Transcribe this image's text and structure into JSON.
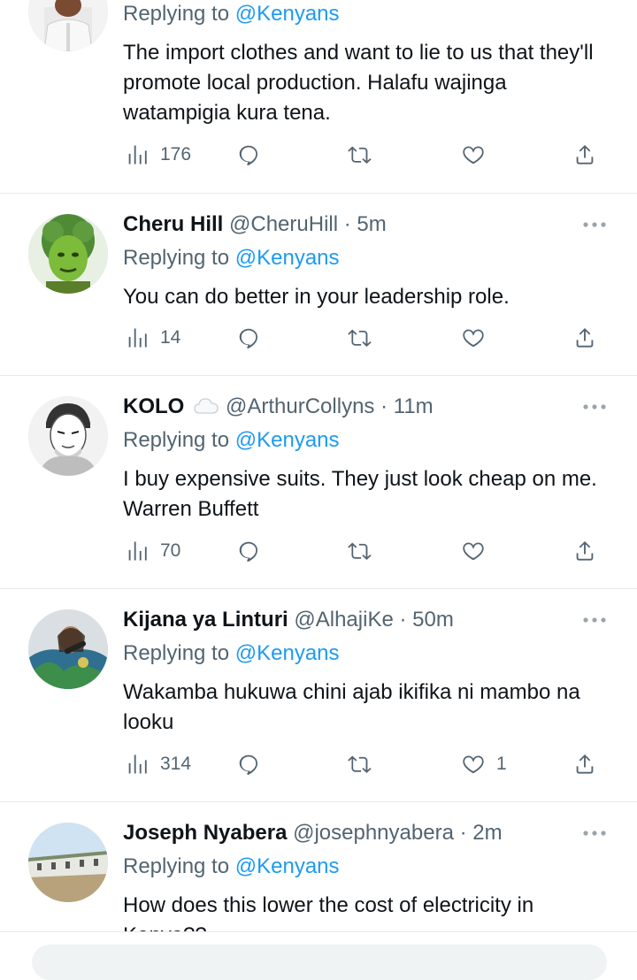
{
  "tweets": [
    {
      "name": "",
      "handle": "",
      "time": "",
      "replying_prefix": "Replying to ",
      "replying_to": "@Kenyans",
      "text": "The import clothes and want to lie to us that they'll promote local production. Halafu wajinga watampigia kura tena.",
      "views": "176",
      "likes": ""
    },
    {
      "name": "Cheru Hill",
      "handle": "@CheruHill",
      "time": "5m",
      "replying_prefix": "Replying to ",
      "replying_to": "@Kenyans",
      "text": "You can do better in your leadership role.",
      "views": "14",
      "likes": ""
    },
    {
      "name": "KOLO",
      "handle": "@ArthurCollyns",
      "time": "11m",
      "replying_prefix": "Replying to ",
      "replying_to": "@Kenyans",
      "text": "I buy expensive suits. They just look cheap on me. Warren Buffett",
      "views": "70",
      "likes": ""
    },
    {
      "name": "Kijana ya Linturi",
      "handle": "@AlhajiKe",
      "time": "50m",
      "replying_prefix": "Replying to ",
      "replying_to": "@Kenyans",
      "text": "Wakamba hukuwa chini ajab ikifika ni mambo na looku",
      "views": "314",
      "likes": "1"
    },
    {
      "name": "Joseph Nyabera",
      "handle": "@josephnyabera",
      "time": "2m",
      "replying_prefix": "Replying to ",
      "replying_to": "@Kenyans",
      "text": "How does this lower the cost of electricity in Kenya??",
      "views": "",
      "likes": ""
    }
  ],
  "separator": "·",
  "icons": {
    "views": "views-bar-chart-icon",
    "reply": "reply-bubble-icon",
    "retweet": "retweet-icon",
    "like": "heart-icon",
    "share": "share-upload-icon",
    "more": "more-dots-icon"
  },
  "colors": {
    "text": "#0f1419",
    "secondary": "#536471",
    "mention": "#1d9bf0",
    "divider": "#e6e9ea"
  }
}
